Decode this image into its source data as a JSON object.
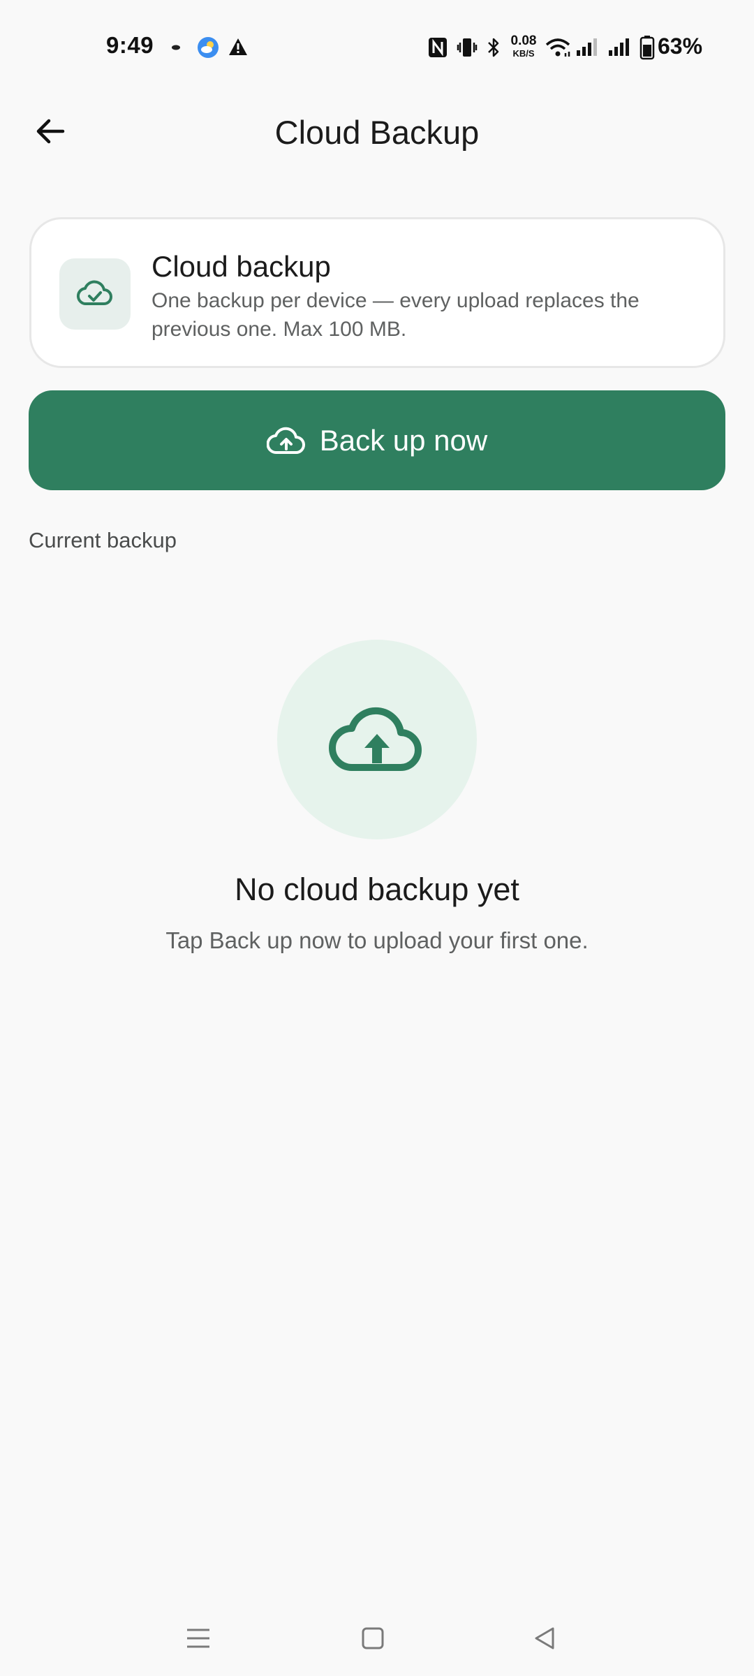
{
  "status_bar": {
    "time": "9:49",
    "net_speed_value": "0.08",
    "net_speed_unit": "KB/S",
    "battery_percent": "63%"
  },
  "header": {
    "title": "Cloud Backup"
  },
  "info_card": {
    "title": "Cloud backup",
    "description": "One backup per device — every upload replaces the previous one. Max 100 MB."
  },
  "primary_button": {
    "label": "Back up now"
  },
  "section": {
    "label": "Current backup"
  },
  "empty_state": {
    "title": "No cloud backup yet",
    "subtitle": "Tap Back up now to upload your first one."
  },
  "colors": {
    "accent": "#2f7f5f",
    "accent_light": "#e6f3ec",
    "background": "#f9f9f9"
  }
}
